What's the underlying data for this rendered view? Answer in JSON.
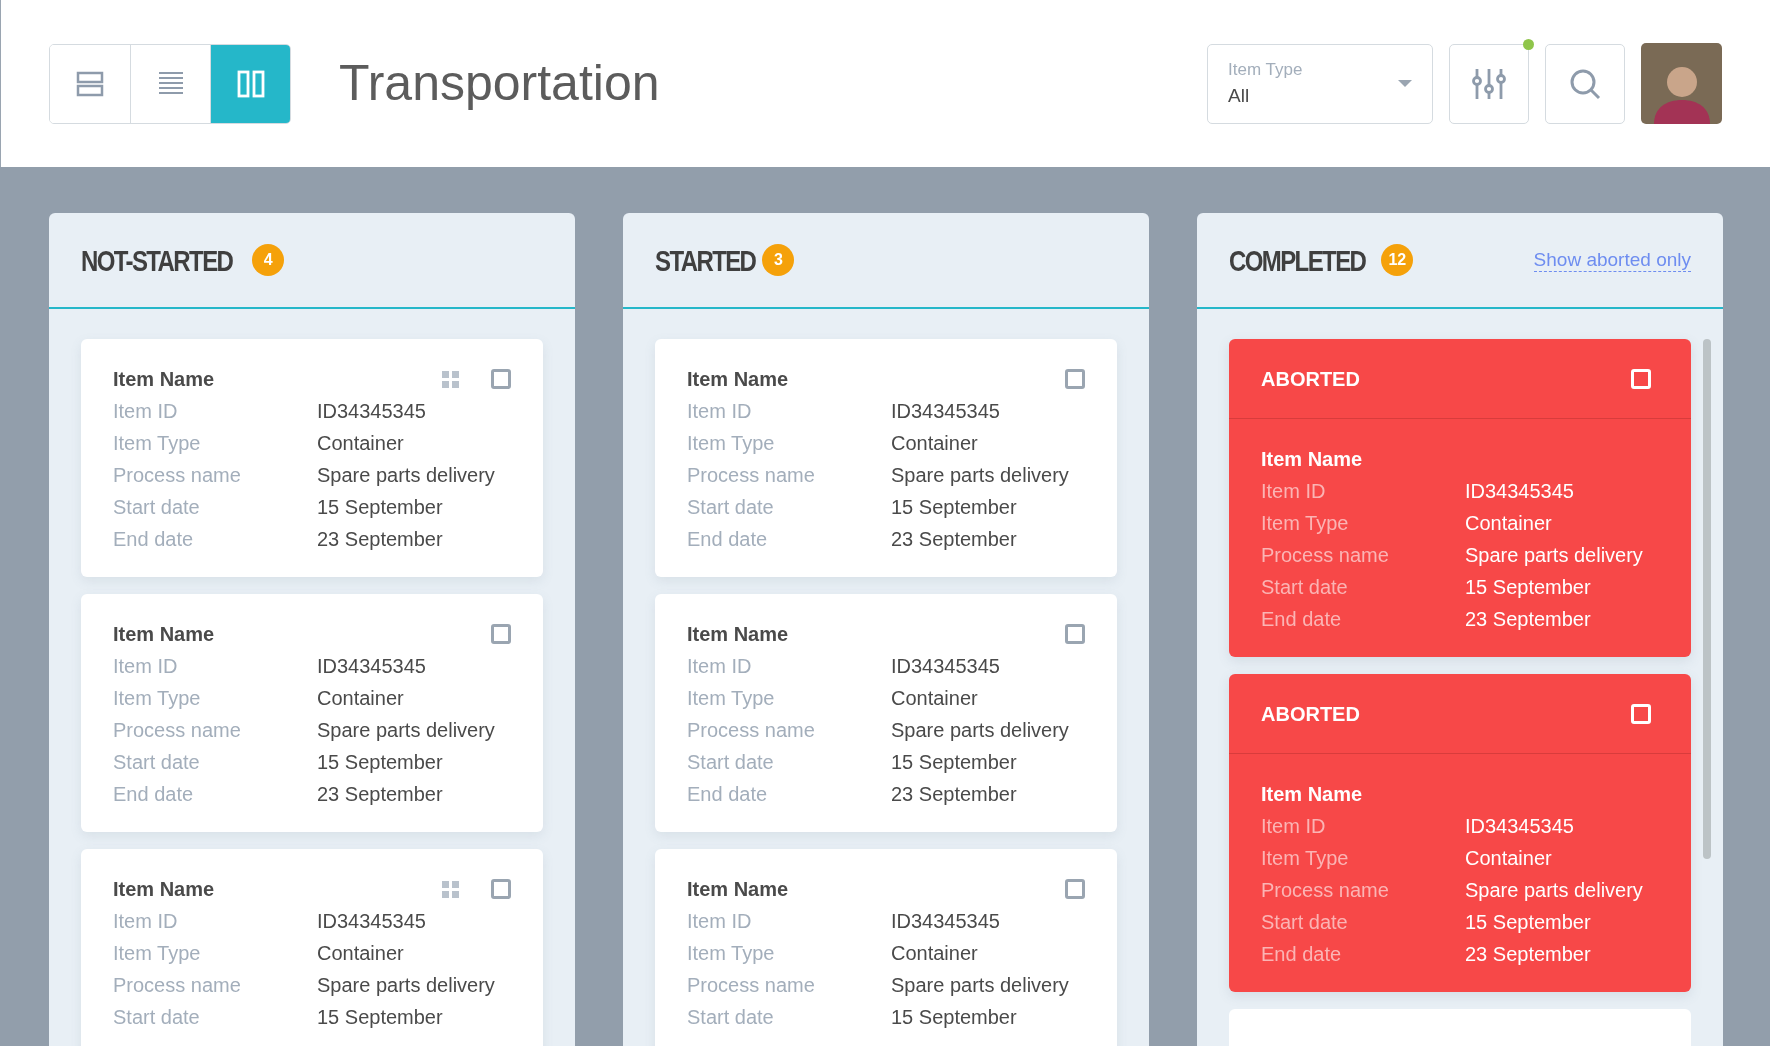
{
  "header": {
    "view_buttons": [
      {
        "kind": "rows",
        "selected": false
      },
      {
        "kind": "list",
        "selected": false
      },
      {
        "kind": "columns",
        "selected": true
      }
    ],
    "title": "Transportation",
    "item_type": {
      "label": "Item Type",
      "value": "All"
    },
    "filter": {
      "notification": true
    }
  },
  "columns": [
    {
      "title": "NOT-STARTED",
      "count": "4",
      "cards": [
        {
          "kind": "item",
          "title": "Item Name",
          "draggable": true,
          "checked": false,
          "fields": [
            {
              "label": "Item ID",
              "value": "ID34345345"
            },
            {
              "label": "Item Type",
              "value": "Container"
            },
            {
              "label": "Process name",
              "value": "Spare parts delivery"
            },
            {
              "label": "Start date",
              "value": "15 September"
            },
            {
              "label": "End date",
              "value": "23 September"
            }
          ]
        },
        {
          "kind": "item",
          "title": "Item Name",
          "draggable": false,
          "checked": false,
          "fields": [
            {
              "label": "Item ID",
              "value": "ID34345345"
            },
            {
              "label": "Item Type",
              "value": "Container"
            },
            {
              "label": "Process name",
              "value": "Spare parts delivery"
            },
            {
              "label": "Start date",
              "value": "15 September"
            },
            {
              "label": "End date",
              "value": "23 September"
            }
          ]
        },
        {
          "kind": "item",
          "title": "Item Name",
          "draggable": true,
          "checked": false,
          "fields": [
            {
              "label": "Item ID",
              "value": "ID34345345"
            },
            {
              "label": "Item Type",
              "value": "Container"
            },
            {
              "label": "Process name",
              "value": "Spare parts delivery"
            },
            {
              "label": "Start date",
              "value": "15 September"
            }
          ]
        }
      ]
    },
    {
      "title": "STARTED",
      "count": "3",
      "cards": [
        {
          "kind": "item",
          "title": "Item Name",
          "draggable": false,
          "checked": false,
          "fields": [
            {
              "label": "Item ID",
              "value": "ID34345345"
            },
            {
              "label": "Item Type",
              "value": "Container"
            },
            {
              "label": "Process name",
              "value": "Spare parts delivery"
            },
            {
              "label": "Start date",
              "value": "15 September"
            },
            {
              "label": "End date",
              "value": "23 September"
            }
          ]
        },
        {
          "kind": "item",
          "title": "Item Name",
          "draggable": false,
          "checked": false,
          "fields": [
            {
              "label": "Item ID",
              "value": "ID34345345"
            },
            {
              "label": "Item Type",
              "value": "Container"
            },
            {
              "label": "Process name",
              "value": "Spare parts delivery"
            },
            {
              "label": "Start date",
              "value": "15 September"
            },
            {
              "label": "End date",
              "value": "23 September"
            }
          ]
        },
        {
          "kind": "item",
          "title": "Item Name",
          "draggable": false,
          "checked": false,
          "fields": [
            {
              "label": "Item ID",
              "value": "ID34345345"
            },
            {
              "label": "Item Type",
              "value": "Container"
            },
            {
              "label": "Process name",
              "value": "Spare parts delivery"
            },
            {
              "label": "Start date",
              "value": "15 September"
            }
          ]
        }
      ]
    },
    {
      "title": "COMPLETED",
      "count": "12",
      "link": "Show aborted only",
      "cards": [
        {
          "kind": "aborted",
          "status": "ABORTED",
          "title": "Item Name",
          "checked": false,
          "fields": [
            {
              "label": "Item ID",
              "value": "ID34345345"
            },
            {
              "label": "Item Type",
              "value": "Container"
            },
            {
              "label": "Process name",
              "value": "Spare parts delivery"
            },
            {
              "label": "Start date",
              "value": "15 September"
            },
            {
              "label": "End date",
              "value": "23 September"
            }
          ]
        },
        {
          "kind": "aborted",
          "status": "ABORTED",
          "title": "Item Name",
          "checked": false,
          "fields": [
            {
              "label": "Item ID",
              "value": "ID34345345"
            },
            {
              "label": "Item Type",
              "value": "Container"
            },
            {
              "label": "Process name",
              "value": "Spare parts delivery"
            },
            {
              "label": "Start date",
              "value": "15 September"
            },
            {
              "label": "End date",
              "value": "23 September"
            }
          ]
        },
        {
          "kind": "blank"
        }
      ]
    }
  ]
}
